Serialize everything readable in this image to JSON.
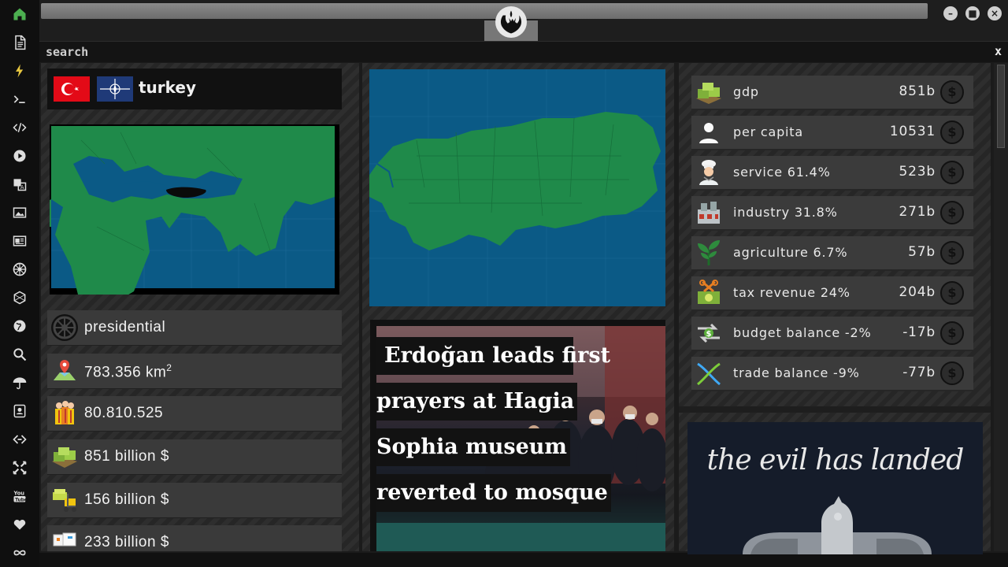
{
  "window": {
    "emblem": "rebel-alliance-emblem",
    "controls": [
      "minimize",
      "maximize",
      "close"
    ]
  },
  "sidebar": {
    "icons": [
      "home-icon",
      "document-icon",
      "lightning-icon",
      "terminal-icon",
      "code-icon",
      "play-icon",
      "translate-icon",
      "image-icon",
      "newspaper-icon",
      "empire-icon",
      "hexagon-icon",
      "globe-icon",
      "search-icon",
      "umbrella-icon",
      "contact-icon",
      "share-icon",
      "crosshair-icon",
      "youtube-icon",
      "heart-icon",
      "infinity-icon"
    ],
    "active_color": "#4caf50"
  },
  "search": {
    "label": "search",
    "close_label": "x"
  },
  "country": {
    "name": "turkey",
    "flags": [
      "turkey-flag",
      "nato-flag"
    ],
    "info": [
      {
        "icon": "empire-icon",
        "text": "presidential"
      },
      {
        "icon": "map-pin-icon",
        "text": "783.356 km",
        "sup": "2"
      },
      {
        "icon": "population-icon",
        "text": "80.810.525"
      },
      {
        "icon": "money-icon",
        "text": "851 billion $"
      },
      {
        "icon": "money-forklift-icon",
        "text": "156 billion $"
      },
      {
        "icon": "boxes-icon",
        "text": "233 billion $"
      }
    ]
  },
  "news": {
    "headline_lines": [
      "Erdoğan leads first",
      "prayers at Hagia",
      "Sophia museum",
      "reverted to mosque"
    ]
  },
  "economy": [
    {
      "icon": "money-stack-icon",
      "label": "gdp",
      "value": "851b",
      "currency": "$"
    },
    {
      "icon": "person-icon",
      "label": "per capita",
      "value": "10531",
      "currency": "$"
    },
    {
      "icon": "chef-icon",
      "label": "service 61.4%",
      "value": "523b",
      "currency": "$"
    },
    {
      "icon": "factory-icon",
      "label": "industry 31.8%",
      "value": "271b",
      "currency": "$"
    },
    {
      "icon": "sprout-icon",
      "label": "agriculture 6.7%",
      "value": "57b",
      "currency": "$"
    },
    {
      "icon": "tax-icon",
      "label": "tax revenue 24%",
      "value": "204b",
      "currency": "$"
    },
    {
      "icon": "balance-arrows-icon",
      "label": "budget balance -2%",
      "value": "-17b",
      "currency": "$"
    },
    {
      "icon": "trade-cross-icon",
      "label": "trade balance -9%",
      "value": "-77b",
      "currency": "$"
    }
  ],
  "poster": {
    "text": "the evil has landed"
  },
  "colors": {
    "map_water": "#0b5a86",
    "map_land": "#1f8a4a",
    "accent": "#4caf50",
    "panel": "#3a3a3a"
  }
}
